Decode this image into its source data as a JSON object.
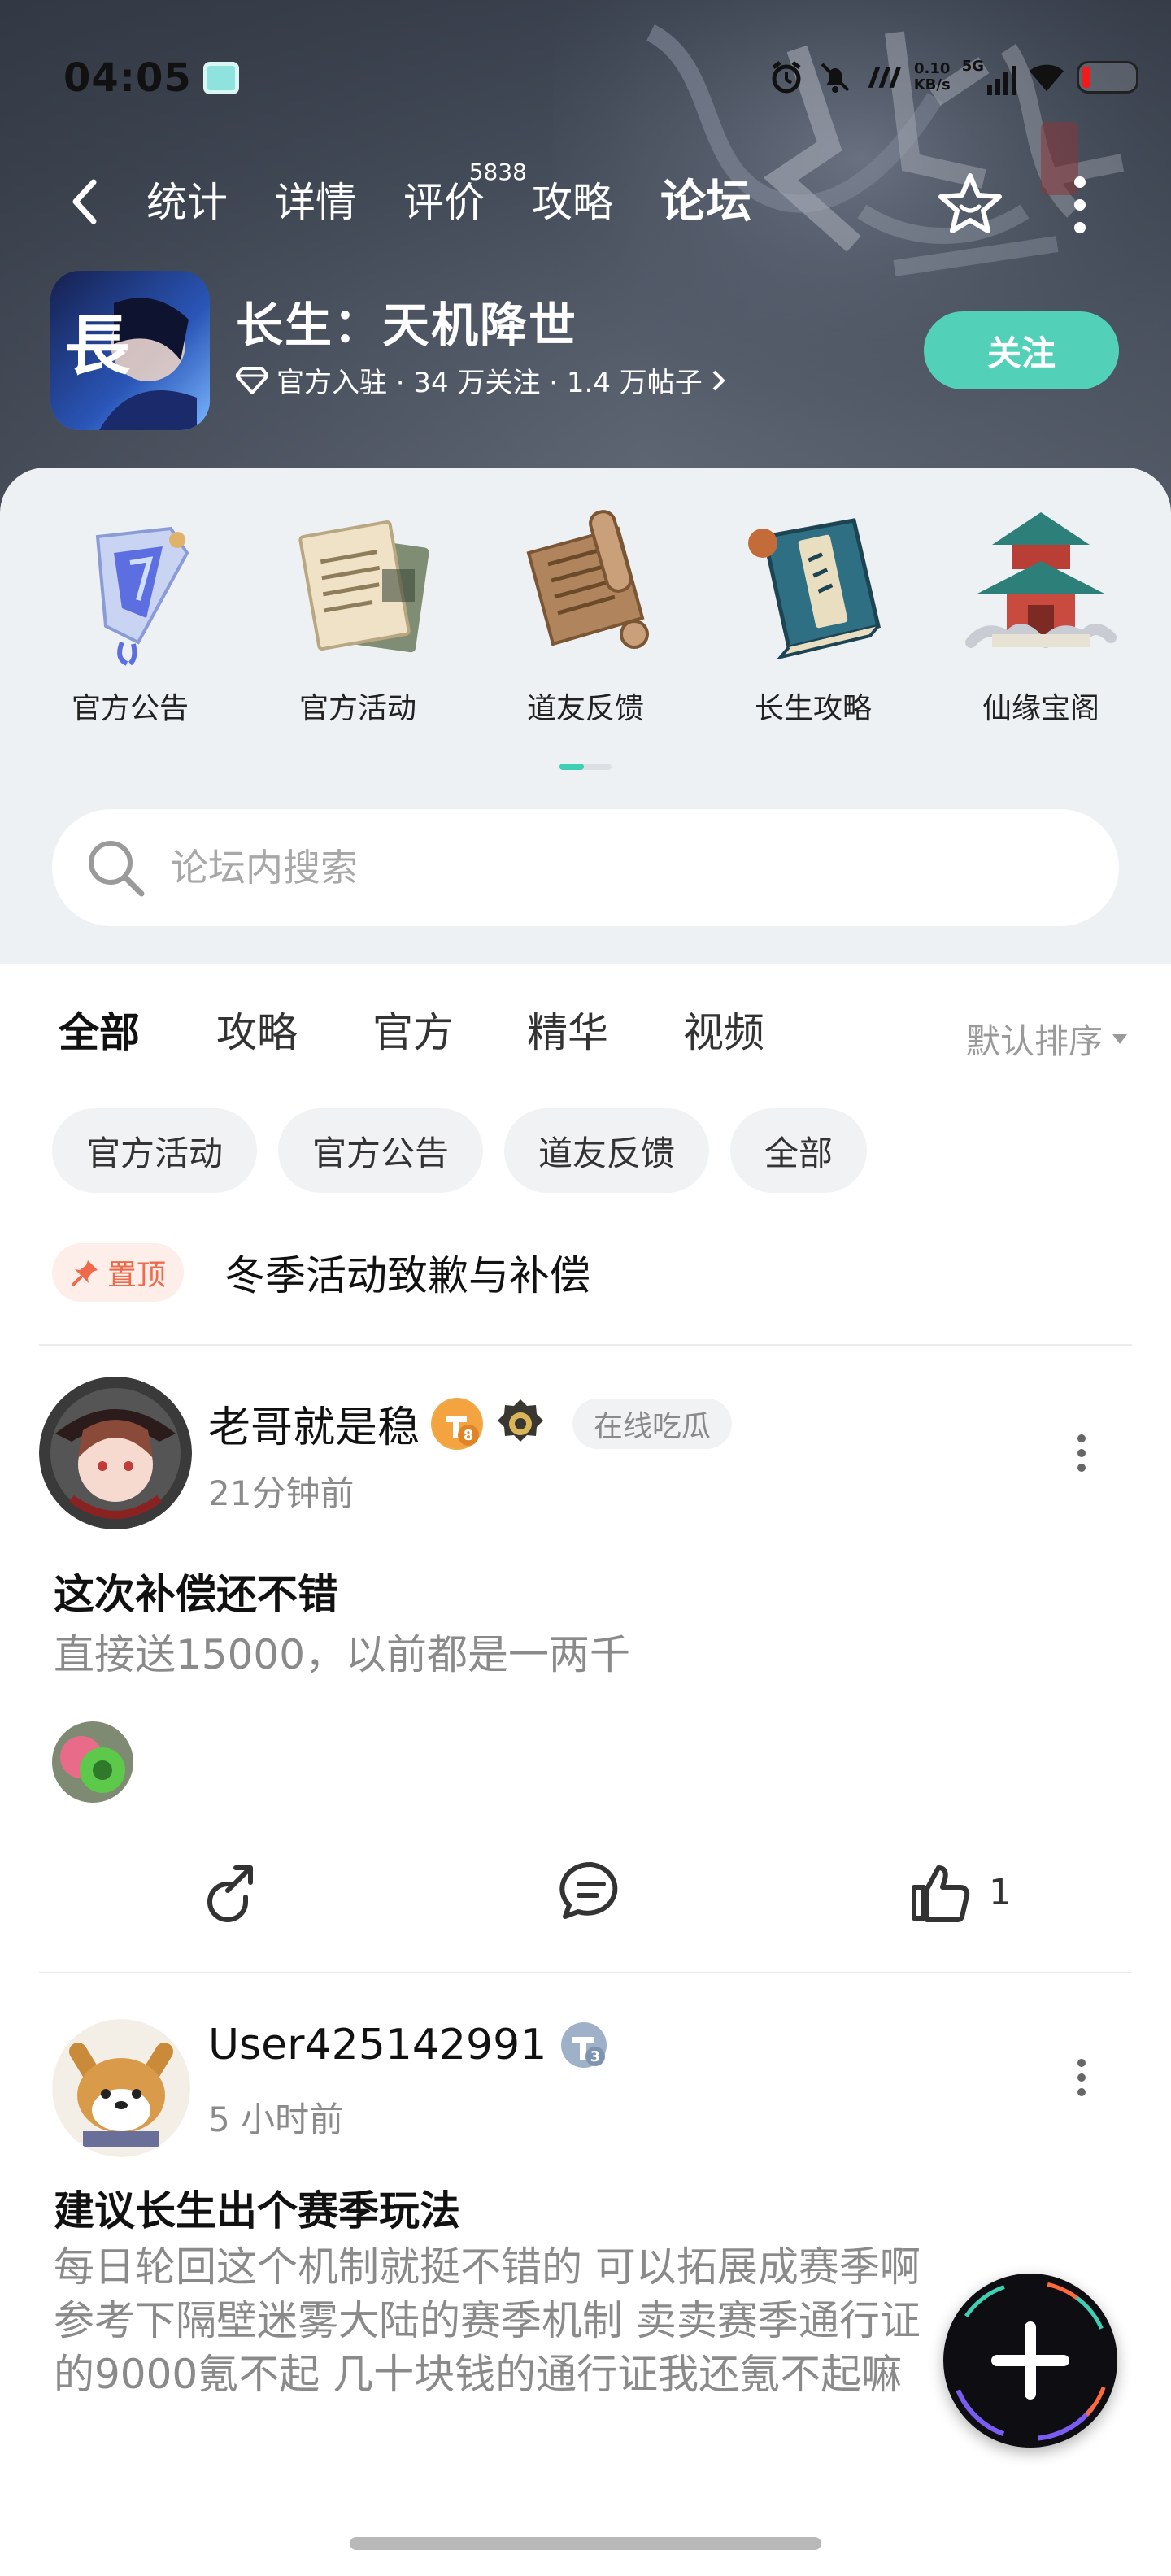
{
  "status": {
    "time": "04:05",
    "netspeed_top": "0.10",
    "netspeed_unit": "KB/s",
    "network": "5G"
  },
  "nav": {
    "tabs": [
      {
        "label": "统计"
      },
      {
        "label": "详情"
      },
      {
        "label": "评价",
        "badge": "5838"
      },
      {
        "label": "攻略"
      },
      {
        "label": "论坛",
        "active": true
      }
    ]
  },
  "game": {
    "name": "长生：天机降世",
    "meta": "官方入驻 · 34 万关注 · 1.4 万帖子",
    "follow_label": "关注",
    "icon_glyph": "長"
  },
  "categories": [
    {
      "label": "官方公告",
      "icon": "announcement-icon"
    },
    {
      "label": "官方活动",
      "icon": "activity-icon"
    },
    {
      "label": "道友反馈",
      "icon": "feedback-scroll-icon"
    },
    {
      "label": "长生攻略",
      "icon": "guide-book-icon"
    },
    {
      "label": "仙缘宝阁",
      "icon": "pavilion-icon"
    }
  ],
  "search": {
    "placeholder": "论坛内搜索"
  },
  "filters": {
    "tabs": [
      "全部",
      "攻略",
      "官方",
      "精华",
      "视频"
    ],
    "active": "全部",
    "sort_label": "默认排序",
    "chips": [
      "官方活动",
      "官方公告",
      "道友反馈",
      "全部"
    ]
  },
  "pinned": {
    "badge": "置顶",
    "title": "冬季活动致歉与补偿"
  },
  "posts": [
    {
      "author": "老哥就是稳",
      "level": "8",
      "tag": "在线吃瓜",
      "time": "21分钟前",
      "title": "这次补偿还不错",
      "body": "直接送15000，以前都是一两千",
      "likes": "1"
    },
    {
      "author": "User425142991",
      "level": "3",
      "time": "5 小时前",
      "title": "建议长生出个赛季玩法",
      "body_lines": [
        "每日轮回这个机制就挺不错的 可以拓展成赛季啊",
        "参考下隔壁迷雾大陆的赛季机制 卖卖赛季通行证",
        "的9000氪不起 几十块钱的通行证我还氪不起嘛"
      ]
    }
  ],
  "colors": {
    "accent": "#3fcfb5",
    "follow_button": "#52d1b8",
    "pin": "#ee6a4a"
  }
}
